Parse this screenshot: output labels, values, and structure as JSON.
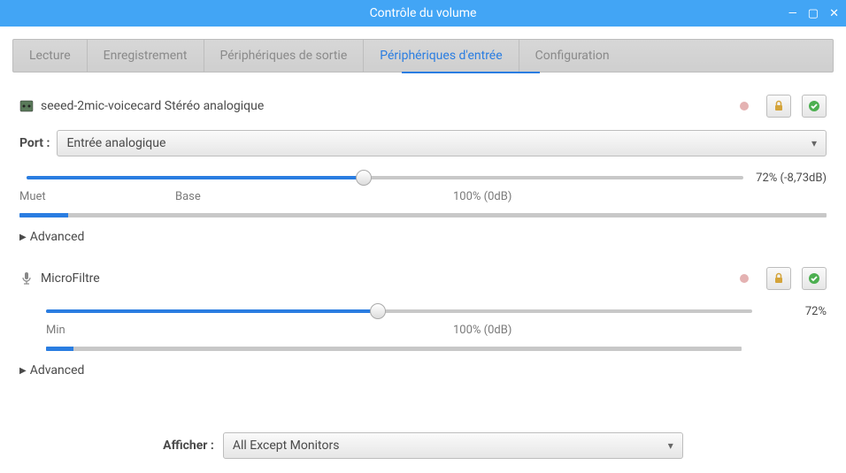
{
  "window": {
    "title": "Contrôle du volume"
  },
  "tabs": [
    "Lecture",
    "Enregistrement",
    "Périphériques de sortie",
    "Périphériques d'entrée",
    "Configuration"
  ],
  "active_tab_index": 3,
  "devices": [
    {
      "name": "seeed-2mic-voicecard Stéréo analogique",
      "port_label": "Port :",
      "port_value": "Entrée analogique",
      "volume_percent": 72,
      "volume_text": "72% (-8,73dB)",
      "scale_min": "Muet",
      "scale_base": "Base",
      "scale_100": "100% (0dB)",
      "level_percent": 6,
      "advanced": "Advanced",
      "icons": {
        "device": "soundcard-icon",
        "mute": "pink-dot",
        "lock": "lock-icon",
        "default": "check-circle-icon"
      }
    },
    {
      "name": "MicroFiltre",
      "volume_percent": 72,
      "volume_text": "72%",
      "scale_min": "Min",
      "scale_100": "100% (0dB)",
      "level_percent": 4,
      "advanced": "Advanced",
      "icons": {
        "device": "microphone-icon",
        "mute": "pink-dot",
        "lock": "lock-icon",
        "default": "check-circle-icon"
      }
    }
  ],
  "footer": {
    "show_label": "Afficher :",
    "show_value": "All Except Monitors"
  },
  "colors": {
    "accent": "#2a7de1",
    "titlebar": "#42a5f5"
  }
}
